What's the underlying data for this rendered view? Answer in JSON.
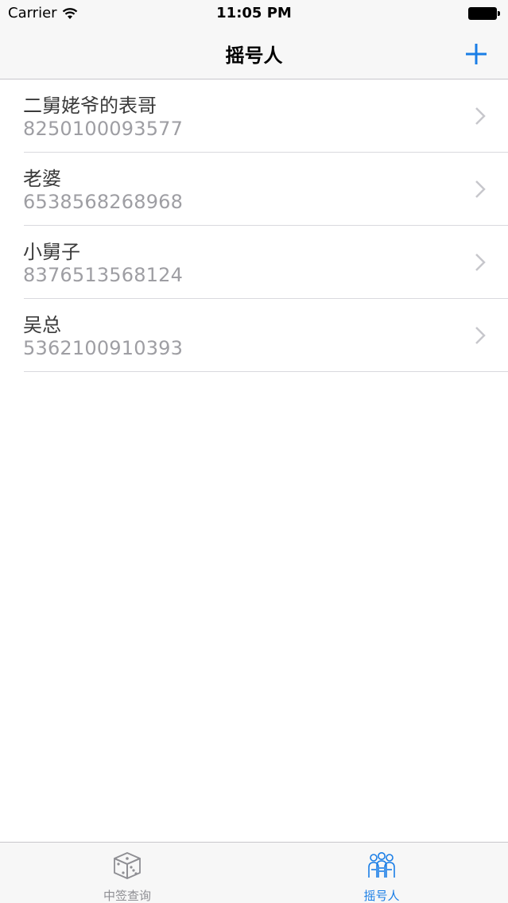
{
  "status_bar": {
    "carrier": "Carrier",
    "time": "11:05 PM"
  },
  "nav": {
    "title": "摇号人",
    "add_icon": "plus-icon",
    "accent_color": "#1a7ee6"
  },
  "list": {
    "items": [
      {
        "name": "二舅姥爷的表哥",
        "number": "8250100093577"
      },
      {
        "name": "老婆",
        "number": "6538568268968"
      },
      {
        "name": "小舅子",
        "number": "8376513568124"
      },
      {
        "name": "吴总",
        "number": "5362100910393"
      }
    ]
  },
  "tab_bar": {
    "tabs": [
      {
        "label": "中签查询",
        "icon": "dice-icon",
        "selected": false,
        "color": "#8e8e93"
      },
      {
        "label": "摇号人",
        "icon": "people-icon",
        "selected": true,
        "color": "#1a7ee6"
      }
    ]
  }
}
